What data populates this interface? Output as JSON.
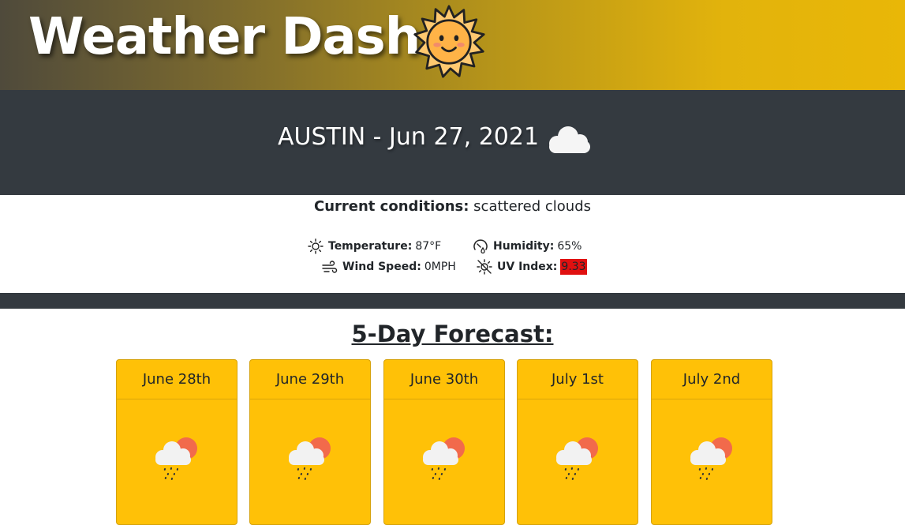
{
  "header": {
    "title": "Weather Dash",
    "logo_icon": "smiling-sun-icon"
  },
  "city_bar": {
    "title": "AUSTIN - Jun 27, 2021",
    "weather_icon": "cloud-icon"
  },
  "current": {
    "conditions_label": "Current conditions:",
    "conditions_value": "scattered clouds",
    "temperature": {
      "label": "Temperature:",
      "value": "87°F",
      "icon": "sun-icon"
    },
    "humidity": {
      "label": "Humidity:",
      "value": "65%",
      "icon": "humidity-gauge-icon"
    },
    "wind": {
      "label": "Wind Speed:",
      "value": "0MPH",
      "icon": "wind-icon"
    },
    "uv": {
      "label": "UV Index:",
      "value": "9.33",
      "icon": "uv-sun-icon",
      "color": "#e01010"
    }
  },
  "forecast": {
    "title": "5-Day Forecast:",
    "card_color": "#ffc107",
    "days": [
      {
        "date": "June 28th",
        "icon": "rain-cloud-sun-icon"
      },
      {
        "date": "June 29th",
        "icon": "rain-cloud-sun-icon"
      },
      {
        "date": "June 30th",
        "icon": "rain-cloud-sun-icon"
      },
      {
        "date": "July 1st",
        "icon": "rain-cloud-sun-icon"
      },
      {
        "date": "July 2nd",
        "icon": "rain-cloud-sun-icon"
      }
    ]
  }
}
